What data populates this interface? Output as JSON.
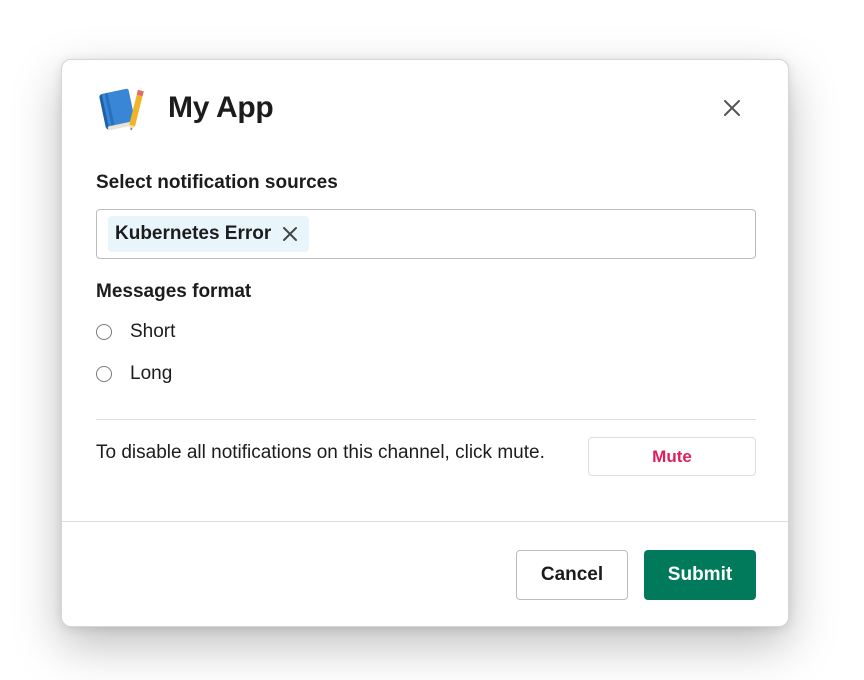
{
  "header": {
    "title": "My App",
    "app_icon": "notebook-icon",
    "close_icon": "close-icon"
  },
  "notification_sources": {
    "label": "Select notification sources",
    "selected": [
      {
        "label": "Kubernetes Error",
        "remove_icon": "close-icon"
      }
    ]
  },
  "messages_format": {
    "label": "Messages format",
    "options": [
      {
        "label": "Short",
        "checked": false
      },
      {
        "label": "Long",
        "checked": false
      }
    ]
  },
  "mute_section": {
    "text": "To disable all notifications on this channel, click mute.",
    "button_label": "Mute"
  },
  "footer": {
    "cancel_label": "Cancel",
    "submit_label": "Submit"
  },
  "colors": {
    "primary": "#007a5a",
    "danger": "#e01e5a",
    "chip_bg": "#e8f5fa",
    "text": "#1d1c1d"
  }
}
